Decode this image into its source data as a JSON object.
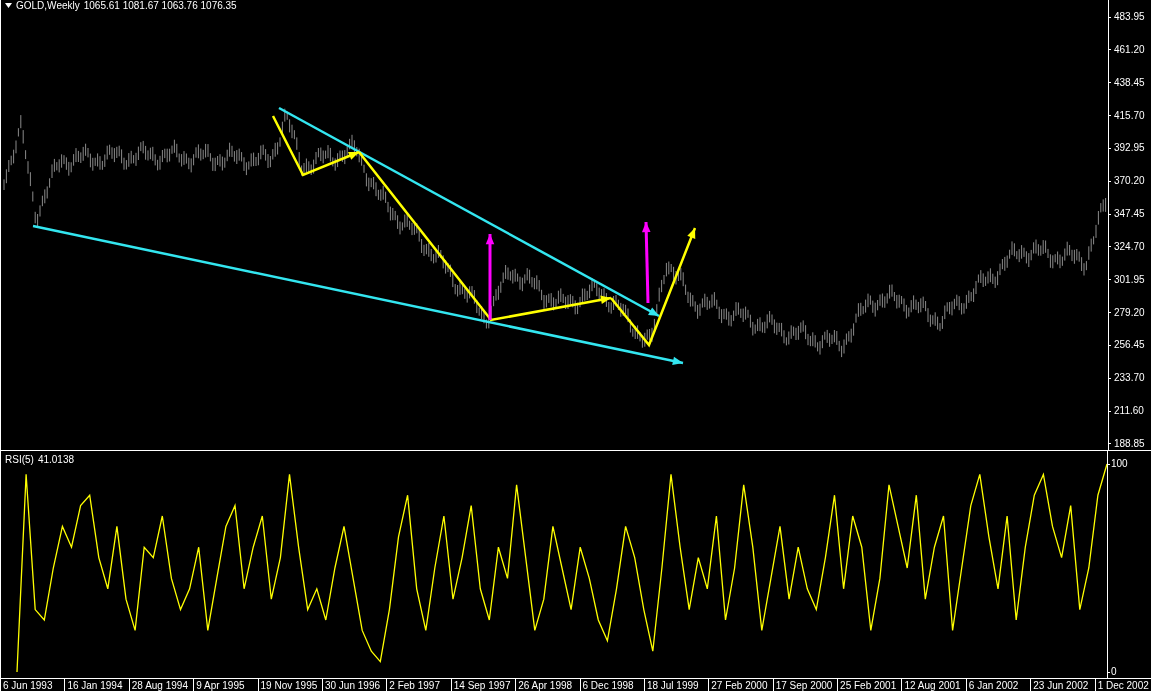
{
  "main_panel": {
    "symbol": "GOLD,Weekly",
    "ohlc": "1065.61 1081.67 1063.76 1076.35",
    "price_axis": [
      "483.95",
      "461.20",
      "438.45",
      "415.70",
      "392.95",
      "370.20",
      "347.45",
      "324.70",
      "301.95",
      "279.20",
      "256.45",
      "233.70",
      "211.60",
      "188.85"
    ]
  },
  "indicator_panel": {
    "reading": "41.0138",
    "chart_data": {
      "type": "line",
      "ylim": [
        0,
        100
      ],
      "yticks": [
        {
          "value": 100,
          "label": "100"
        },
        {
          "value": 0,
          "label": "0"
        }
      ],
      "series": [
        {
          "name": "RSI(5)",
          "color": "#ffff00",
          "values": [
            0,
            95,
            30,
            25,
            50,
            70,
            60,
            80,
            85,
            55,
            40,
            70,
            35,
            20,
            60,
            55,
            75,
            45,
            30,
            40,
            60,
            20,
            45,
            70,
            80,
            40,
            60,
            75,
            35,
            55,
            95,
            60,
            30,
            40,
            25,
            50,
            70,
            45,
            20,
            10,
            5,
            30,
            65,
            85,
            40,
            20,
            50,
            75,
            35,
            55,
            80,
            40,
            25,
            60,
            45,
            90,
            55,
            20,
            35,
            70,
            50,
            30,
            60,
            45,
            25,
            15,
            40,
            70,
            55,
            30,
            10,
            50,
            95,
            60,
            30,
            55,
            40,
            75,
            25,
            50,
            90,
            60,
            20,
            45,
            70,
            35,
            60,
            40,
            30,
            55,
            85,
            40,
            75,
            60,
            20,
            45,
            90,
            70,
            50,
            85,
            35,
            60,
            75,
            20,
            50,
            80,
            95,
            65,
            40,
            75,
            25,
            60,
            85,
            95,
            70,
            55,
            80,
            30,
            50,
            85,
            100
          ]
        }
      ]
    }
  },
  "time_axis": [
    "6 Jun 1993",
    "16 Jan 1994",
    "28 Aug 1994",
    "9 Apr 1995",
    "19 Nov 1995",
    "30 Jun 1996",
    "2 Feb 1997",
    "14 Sep 1997",
    "26 Apr 1998",
    "6 Dec 1998",
    "18 Jul 1999",
    "27 Feb 2000",
    "17 Sep 2000",
    "25 Feb 2001",
    "12 Aug 2001",
    "6 Jan 2002",
    "23 Jun 2002",
    "1 Dec 2002"
  ]
}
